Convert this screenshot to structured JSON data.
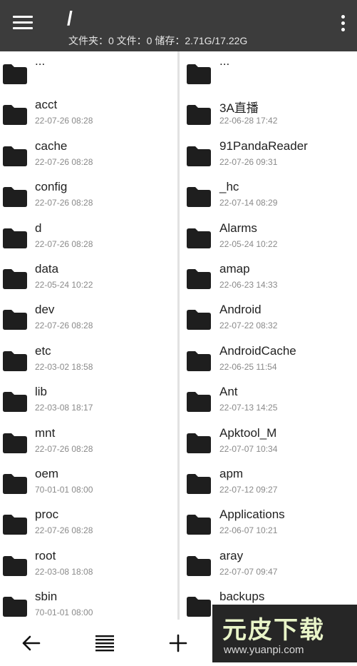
{
  "header": {
    "path": "/",
    "stats": "文件夹：0 文件：0 储存：2.71G/17.22G",
    "menu_icon": "hamburger-menu-icon",
    "more_icon": "more-vertical-icon"
  },
  "left_pane": {
    "items": [
      {
        "name": "...",
        "date": ""
      },
      {
        "name": "acct",
        "date": "22-07-26 08:28"
      },
      {
        "name": "cache",
        "date": "22-07-26 08:28"
      },
      {
        "name": "config",
        "date": "22-07-26 08:28"
      },
      {
        "name": "d",
        "date": "22-07-26 08:28"
      },
      {
        "name": "data",
        "date": "22-05-24 10:22"
      },
      {
        "name": "dev",
        "date": "22-07-26 08:28"
      },
      {
        "name": "etc",
        "date": "22-03-02 18:58"
      },
      {
        "name": "lib",
        "date": "22-03-08 18:17"
      },
      {
        "name": "mnt",
        "date": "22-07-26 08:28"
      },
      {
        "name": "oem",
        "date": "70-01-01 08:00"
      },
      {
        "name": "proc",
        "date": "22-07-26 08:28"
      },
      {
        "name": "root",
        "date": "22-03-08 18:08"
      },
      {
        "name": "sbin",
        "date": "70-01-01 08:00"
      }
    ]
  },
  "right_pane": {
    "items": [
      {
        "name": "...",
        "date": ""
      },
      {
        "name": "3A直播",
        "date": "22-06-28 17:42"
      },
      {
        "name": "91PandaReader",
        "date": "22-07-26 09:31"
      },
      {
        "name": "_hc",
        "date": "22-07-14 08:29"
      },
      {
        "name": "Alarms",
        "date": "22-05-24 10:22"
      },
      {
        "name": "amap",
        "date": "22-06-23 14:33"
      },
      {
        "name": "Android",
        "date": "22-07-22 08:32"
      },
      {
        "name": "AndroidCache",
        "date": "22-06-25 11:54"
      },
      {
        "name": "Ant",
        "date": "22-07-13 14:25"
      },
      {
        "name": "Apktool_M",
        "date": "22-07-07 10:34"
      },
      {
        "name": "apm",
        "date": "22-07-12 09:27"
      },
      {
        "name": "Applications",
        "date": "22-06-07 10:21"
      },
      {
        "name": "aray",
        "date": "22-07-07 09:47"
      },
      {
        "name": "backups",
        "date": ""
      }
    ]
  },
  "bottom_bar": {
    "buttons": [
      {
        "name": "back-button",
        "icon": "arrow-left-icon"
      },
      {
        "name": "select-list-button",
        "icon": "list-lines-icon"
      },
      {
        "name": "add-button",
        "icon": "plus-icon"
      }
    ]
  },
  "watermark": {
    "logo": "元皮下载",
    "url": "www.yuanpi.com"
  },
  "colors": {
    "header_bg": "#3c3c3c",
    "folder": "#1e1e1e",
    "date_text": "#8a8a8a"
  }
}
